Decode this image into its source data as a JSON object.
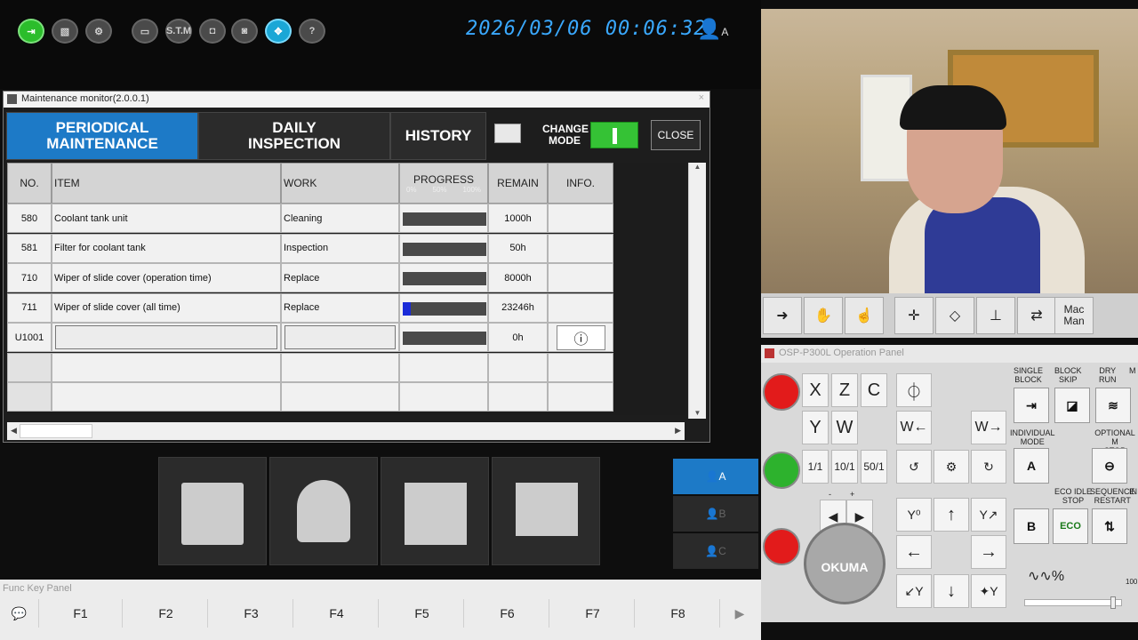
{
  "topbar": {
    "datetime": "2026/03/06  00:06:32",
    "user_label": "A",
    "icons": [
      "exit-icon",
      "image-icon",
      "tool-icon",
      "window-icon",
      "stm-icon",
      "camera-icon",
      "screenshot-icon",
      "move-icon",
      "help-icon"
    ],
    "stm_label": "S.T.M",
    "help_label": "?"
  },
  "window": {
    "title": "Maintenance monitor(2.0.0.1)",
    "tabs": [
      {
        "label": "PERIODICAL\nMAINTENANCE",
        "active": true
      },
      {
        "label": "DAILY\nINSPECTION",
        "active": false
      },
      {
        "label": "HISTORY",
        "active": false
      }
    ],
    "change_mode": "CHANGE\nMODE",
    "close": "CLOSE"
  },
  "table": {
    "headers": [
      "NO.",
      "ITEM",
      "WORK",
      "PROGRESS",
      "REMAIN",
      "INFO."
    ],
    "progress_ticks": [
      "0%",
      "50%",
      "100%"
    ],
    "rows": [
      {
        "no": "580",
        "item": "Coolant tank unit",
        "work": "Cleaning",
        "progress": 0,
        "remain": "1000h",
        "info": false
      },
      {
        "no": "581",
        "item": "Filter for coolant tank",
        "work": "Inspection",
        "progress": 0,
        "remain": "50h",
        "info": false
      },
      {
        "no": "710",
        "item": "Wiper of slide cover (operation time)",
        "work": "Replace",
        "progress": 0,
        "remain": "8000h",
        "info": false
      },
      {
        "no": "711",
        "item": "Wiper of slide cover (all time)",
        "work": "Replace",
        "progress": 0.1,
        "remain": "23246h",
        "info": false
      },
      {
        "no": "U1001",
        "item": "",
        "work": "",
        "progress": 0,
        "remain": "0h",
        "info": true
      },
      {
        "no": "",
        "item": "",
        "work": "",
        "progress": null,
        "remain": "",
        "info": false
      },
      {
        "no": "",
        "item": "",
        "work": "",
        "progress": null,
        "remain": "",
        "info": false
      }
    ]
  },
  "user_tabs": [
    "A",
    "B",
    "C"
  ],
  "func_panel": {
    "title": "Func Key Panel",
    "keys": [
      "F1",
      "F2",
      "F3",
      "F4",
      "F5",
      "F6",
      "F7",
      "F8"
    ]
  },
  "op_panel": {
    "title": "OSP-P300L Operation Panel",
    "axis_keys": [
      "X",
      "Z",
      "C",
      "Y",
      "W"
    ],
    "override": [
      "1/1",
      "10/1",
      "50/1"
    ],
    "labels": {
      "single_block": "SINGLE\nBLOCK",
      "block_skip": "BLOCK\nSKIP",
      "dry_run": "DRY\nRUN",
      "m": "M",
      "individual_mode": "INDIVIDUAL\nMODE",
      "optional_stop": "OPTIONAL M\nSTOP",
      "eco_idle": "ECO IDLE\nSTOP",
      "sequence_restart": "SEQUENCE\nRESTART",
      "in": "IN"
    },
    "keys": {
      "a": "A",
      "b": "B",
      "eco": "ECO",
      "minus": "-",
      "plus": "+",
      "w": "W",
      "y": "Y"
    },
    "dial": "OKUMA",
    "feed_rate": "%",
    "feed_value": "100"
  },
  "mode_bar": {
    "mac_man": "Mac\nMan"
  },
  "colors": {
    "accent": "#1d7ac7",
    "green": "#35c235",
    "red": "#e21b1b",
    "progress_fill": "#1a2bd8"
  }
}
